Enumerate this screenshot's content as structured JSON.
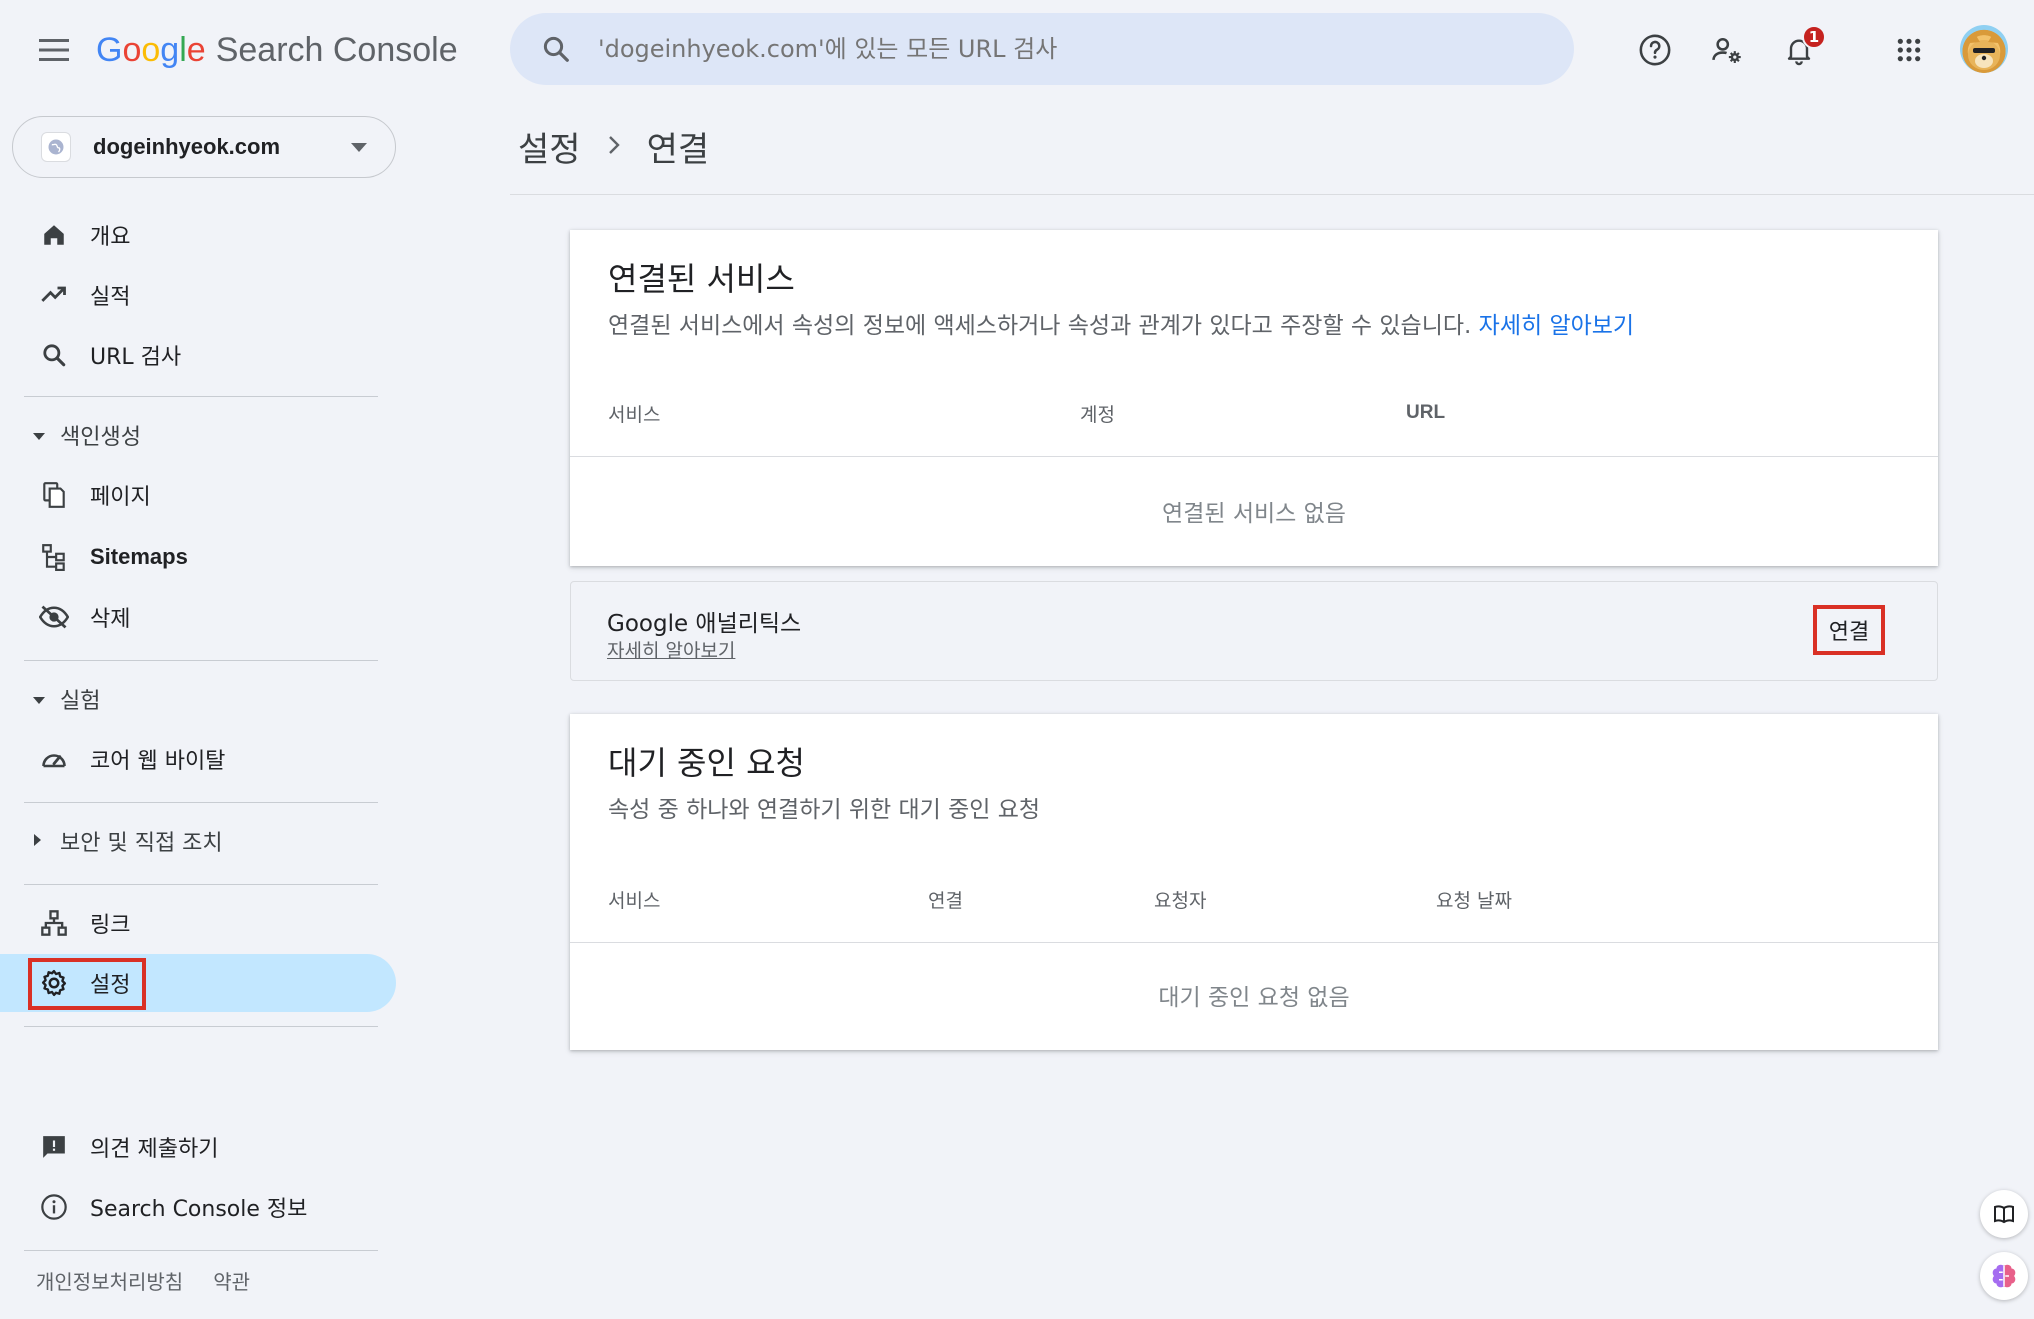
{
  "header": {
    "product_name": "Search Console",
    "search_placeholder": "'dogeinhyeok.com'에 있는 모든 URL 검사",
    "notification_count": "1"
  },
  "property": {
    "name": "dogeinhyeok.com"
  },
  "sidebar": {
    "items": [
      {
        "label": "개요",
        "icon": "home-icon"
      },
      {
        "label": "실적",
        "icon": "trending-up-icon"
      },
      {
        "label": "URL 검사",
        "icon": "search-icon"
      },
      {
        "label": "페이지",
        "icon": "pages-icon"
      },
      {
        "label": "Sitemaps",
        "icon": "sitemap-icon"
      },
      {
        "label": "삭제",
        "icon": "visibility-off-icon"
      },
      {
        "label": "코어 웹 바이탈",
        "icon": "speed-gauge-icon"
      },
      {
        "label": "링크",
        "icon": "links-icon"
      },
      {
        "label": "설정",
        "icon": "gear-icon"
      },
      {
        "label": "의견 제출하기",
        "icon": "feedback-icon"
      },
      {
        "label": "Search Console 정보",
        "icon": "info-icon"
      }
    ],
    "sections": {
      "indexing": "색인생성",
      "experience": "실험",
      "security": "보안 및 직접 조치"
    },
    "footer": {
      "privacy": "개인정보처리방침",
      "terms": "약관"
    }
  },
  "breadcrumb": {
    "parent": "설정",
    "current": "연결"
  },
  "connected_services": {
    "title": "연결된 서비스",
    "description": "연결된 서비스에서 속성의 정보에 액세스하거나 속성과 관계가 있다고 주장할 수 있습니다.",
    "learn_more": "자세히 알아보기",
    "columns": [
      "서비스",
      "계정",
      "URL"
    ],
    "empty": "연결된 서비스 없음"
  },
  "google_analytics": {
    "title": "Google 애널리틱스",
    "learn_more": "자세히 알아보기",
    "connect_label": "연결"
  },
  "pending_requests": {
    "title": "대기 중인 요청",
    "description": "속성 중 하나와 연결하기 위한 대기 중인 요청",
    "columns": [
      "서비스",
      "연결",
      "요청자",
      "요청 날짜"
    ],
    "empty": "대기 중인 요청 없음"
  },
  "colors": {
    "accent": "#1a73e8",
    "active_bg": "#c2e7ff",
    "highlight": "#d93025"
  }
}
